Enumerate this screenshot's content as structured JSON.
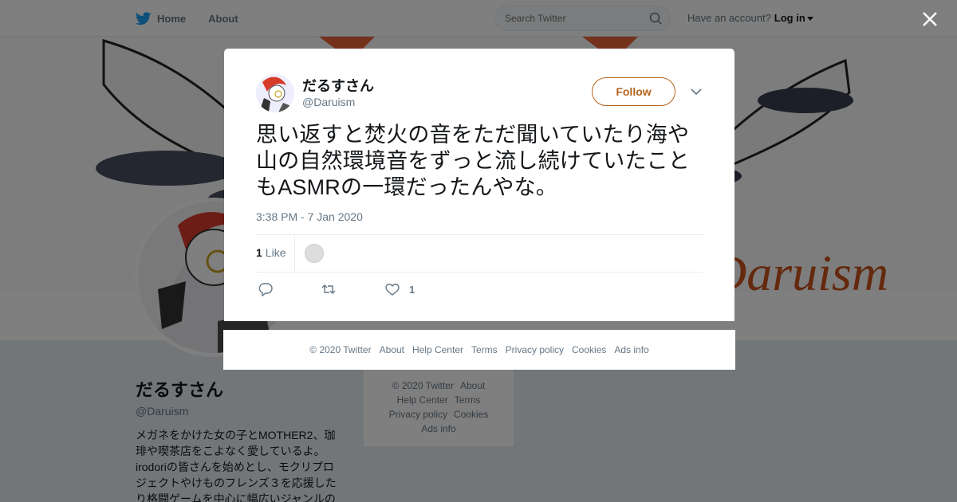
{
  "nav": {
    "home_label": "Home",
    "about_label": "About",
    "search_placeholder": "Search Twitter",
    "account_prompt": "Have an account?",
    "login_label": "Log in"
  },
  "profile": {
    "name": "だるすさん",
    "handle": "@Daruism",
    "bio": "メガネをかけた女の子とMOTHER2、珈琲や喫茶店をこよなく愛しているよ。irodoriの皆さんを始めとし、モクリプロジェクトやけものフレンズ３を応援したり格闘ゲームを中心に幅広いジャンルの",
    "banner_text": "Daruism"
  },
  "background_footer": [
    "© 2020 Twitter",
    "About",
    "Help Center",
    "Terms",
    "Privacy policy",
    "Cookies",
    "Ads info"
  ],
  "tweet": {
    "author_name": "だるすさん",
    "author_handle": "@Daruism",
    "follow_label": "Follow",
    "text": "思い返すと焚火の音をただ聞いていたり海や山の自然環境音をずっと流し続けていたこともASMRの一環だったんやな。",
    "timestamp": "3:38 PM - 7 Jan 2020",
    "like_count": "1",
    "like_label": "Like",
    "action_like_count": "1"
  },
  "modal_footer": [
    "© 2020 Twitter",
    "About",
    "Help Center",
    "Terms",
    "Privacy policy",
    "Cookies",
    "Ads info"
  ],
  "colors": {
    "accent": "#b5651d",
    "twitter_blue": "#1da1f2",
    "muted": "#657786"
  },
  "icons": {
    "logo": "twitter-bird-icon",
    "search": "search-icon",
    "close": "close-icon",
    "reply": "reply-icon",
    "retweet": "retweet-icon",
    "like": "heart-icon"
  }
}
